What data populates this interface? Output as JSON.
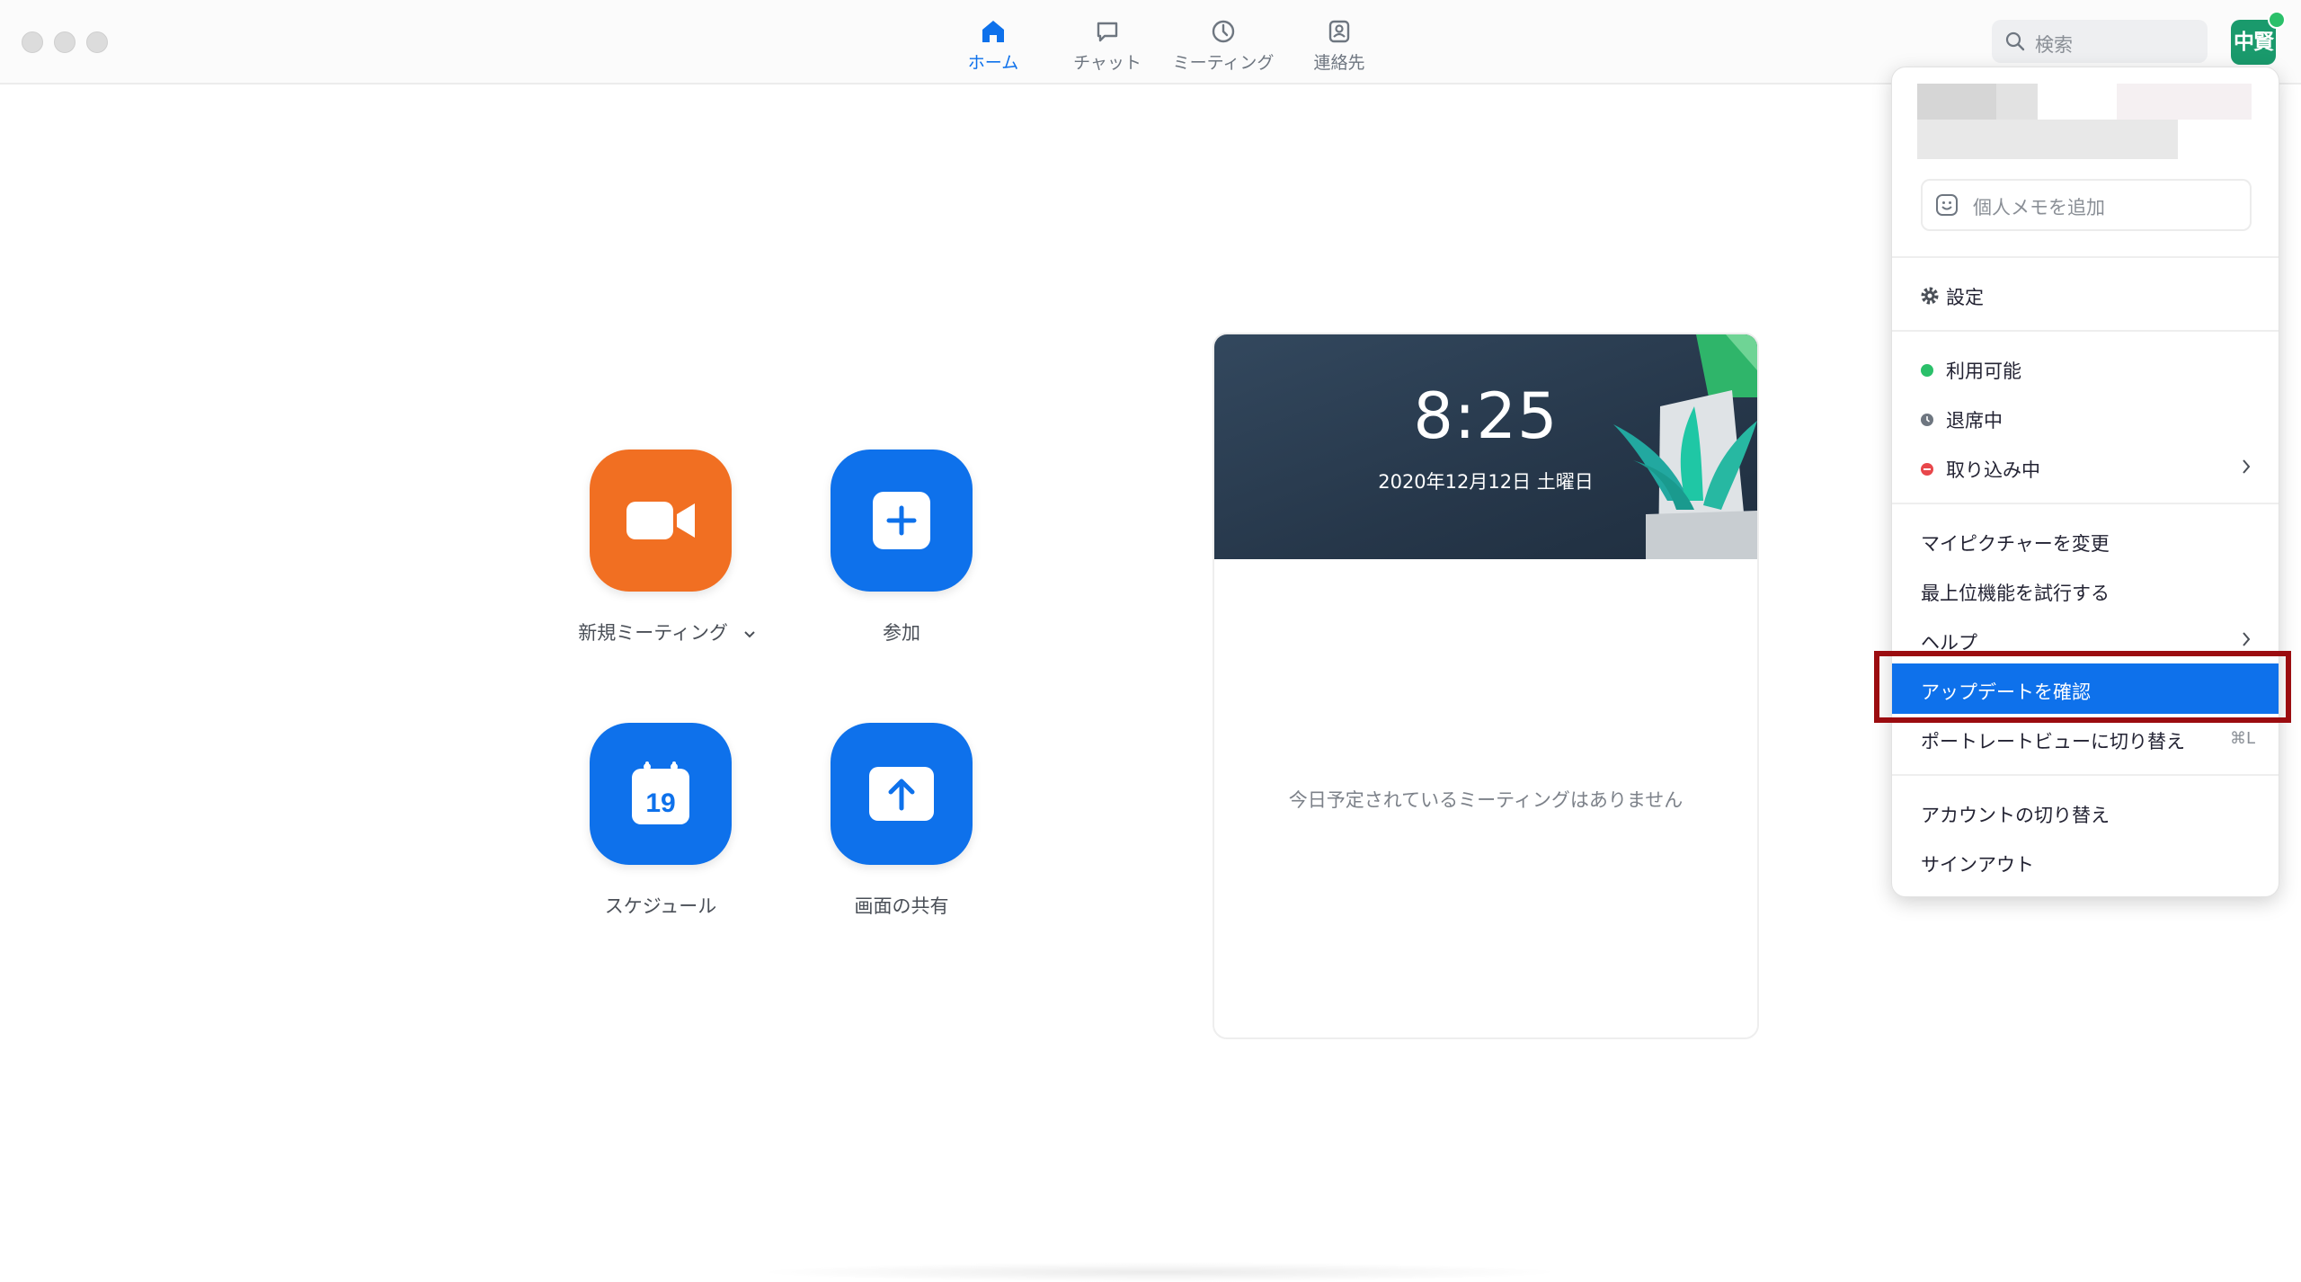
{
  "nav": {
    "tabs": [
      {
        "label": "ホーム",
        "icon": "home-icon",
        "active": true
      },
      {
        "label": "チャット",
        "icon": "chat-icon",
        "active": false
      },
      {
        "label": "ミーティング",
        "icon": "clock-icon",
        "active": false
      },
      {
        "label": "連絡先",
        "icon": "contact-icon",
        "active": false
      }
    ],
    "search_placeholder": "検索",
    "avatar_initials": "中賢"
  },
  "actions": {
    "new_meeting": "新規ミーティング",
    "join": "参加",
    "schedule": "スケジュール",
    "schedule_day": "19",
    "share_screen": "画面の共有"
  },
  "calendar": {
    "time": "8:25",
    "date": "2020年12月12日 土曜日",
    "empty_message": "今日予定されているミーティングはありません"
  },
  "menu": {
    "memo_placeholder": "個人メモを追加",
    "settings": "設定",
    "status": {
      "available": "利用可能",
      "away": "退席中",
      "busy": "取り込み中"
    },
    "change_picture": "マイピクチャーを変更",
    "try_top_features": "最上位機能を試行する",
    "help": "ヘルプ",
    "check_updates": "アップデートを確認",
    "portrait_view": "ポートレートビューに切り替え",
    "portrait_shortcut": "⌘L",
    "switch_account": "アカウントの切り替え",
    "sign_out": "サインアウト"
  },
  "colors": {
    "accent": "#0e71eb",
    "orange": "#f16f22",
    "available": "#2bc06a",
    "busy": "#e8474b",
    "away": "#8a8f96",
    "highlight_border": "#9b0c10"
  }
}
